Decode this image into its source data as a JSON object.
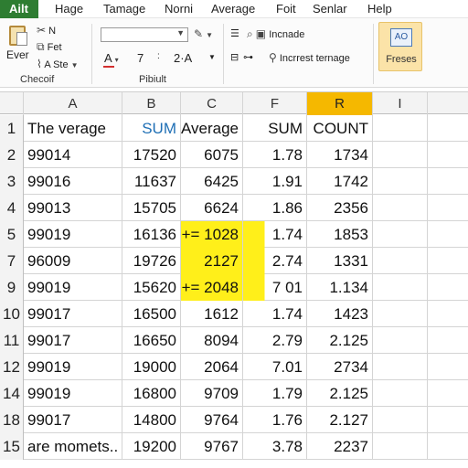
{
  "menubar": {
    "app_tab": "Ailt",
    "items": [
      "Hage",
      "Tamage",
      "Norni",
      "Average",
      "Foit",
      "Senlar",
      "Help"
    ]
  },
  "ribbon": {
    "clipboard": {
      "label1": "Ever",
      "label2": "Checoif",
      "cut": "N",
      "copy": "Fet",
      "format": "A Ste"
    },
    "font": {
      "size_a": "A",
      "size_7": "7",
      "size_2": "2·A",
      "pivot_label": "Pibiult"
    },
    "align": {
      "include": "Incnade",
      "increase": "Incrrest ternage"
    },
    "big_button": {
      "icon_text": "AO",
      "label": "Freses"
    }
  },
  "columns": [
    {
      "letter": "",
      "active": false
    },
    {
      "letter": "A",
      "active": false
    },
    {
      "letter": "B",
      "active": false
    },
    {
      "letter": "C",
      "active": false
    },
    {
      "letter": "F",
      "active": false
    },
    {
      "letter": "R",
      "active": true
    },
    {
      "letter": "I",
      "active": false
    },
    {
      "letter": "",
      "active": false
    }
  ],
  "rows": [
    {
      "num": "1",
      "a": "The verage",
      "b": "SUM",
      "c": "Average",
      "f": "SUM",
      "r": "COUNT"
    },
    {
      "num": "2",
      "a": "99014",
      "b": "17520",
      "c": "6075",
      "f": "1.78",
      "r": "1734"
    },
    {
      "num": "3",
      "a": "99016",
      "b": "11637",
      "c": "6425",
      "f": "1.91",
      "r": "1742"
    },
    {
      "num": "4",
      "a": "99013",
      "b": "15705",
      "c": "6624",
      "f": "1.86",
      "r": "2356"
    },
    {
      "num": "5",
      "a": "99019",
      "b": "16136",
      "c": "+= 1028",
      "f": "1.74",
      "r": "1853"
    },
    {
      "num": "7",
      "a": "96009",
      "b": "19726",
      "c": "2127",
      "f": "2.74",
      "r": "1331"
    },
    {
      "num": "9",
      "a": "99019",
      "b": "15620",
      "c": "+= 2048",
      "f": "7 01",
      "r": "1.134"
    },
    {
      "num": "10",
      "a": "99017",
      "b": "16500",
      "c": "1612",
      "f": "1.74",
      "r": "1423"
    },
    {
      "num": "11",
      "a": "99017",
      "b": "16650",
      "c": "8094",
      "f": "2.79",
      "r": "2.125"
    },
    {
      "num": "12",
      "a": "99019",
      "b": "19000",
      "c": "2064",
      "f": "7.01",
      "r": "2734"
    },
    {
      "num": "14",
      "a": "99019",
      "b": "16800",
      "c": "9709",
      "f": "1.79",
      "r": "2.125"
    },
    {
      "num": "18",
      "a": "99017",
      "b": "14800",
      "c": "9764",
      "f": "1.76",
      "r": "2.127"
    },
    {
      "num": "15",
      "a": "are momets..",
      "b": "19200",
      "c": "9767",
      "f": "3.78",
      "r": "2237"
    }
  ],
  "highlight_color": "#ffef1a",
  "active_column_color": "#f5b800",
  "app_tab_color": "#2e7d32"
}
